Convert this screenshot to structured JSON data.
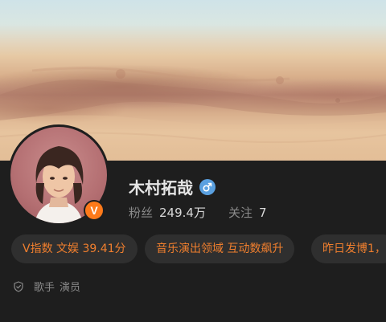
{
  "profile": {
    "name": "木村拓哉",
    "gender_icon": "male-gender-icon",
    "verified_badge": "V",
    "stats": [
      {
        "label": "粉丝",
        "value": "249.4万"
      },
      {
        "label": "关注",
        "value": "7"
      }
    ]
  },
  "chips": [
    {
      "text": "V指数 文娱 39.41分"
    },
    {
      "text": "音乐演出领域 互动数飙升"
    },
    {
      "text": "昨日发博1，"
    }
  ],
  "tags": {
    "icon": "shield-icon",
    "items": [
      "歌手",
      "演员"
    ]
  },
  "colors": {
    "background": "#1e1e1e",
    "chip_background": "#2f2f2f",
    "chip_text": "#f07f2e",
    "verified_badge": "#ff7a1a",
    "gender_icon": "#5aa0e0"
  }
}
